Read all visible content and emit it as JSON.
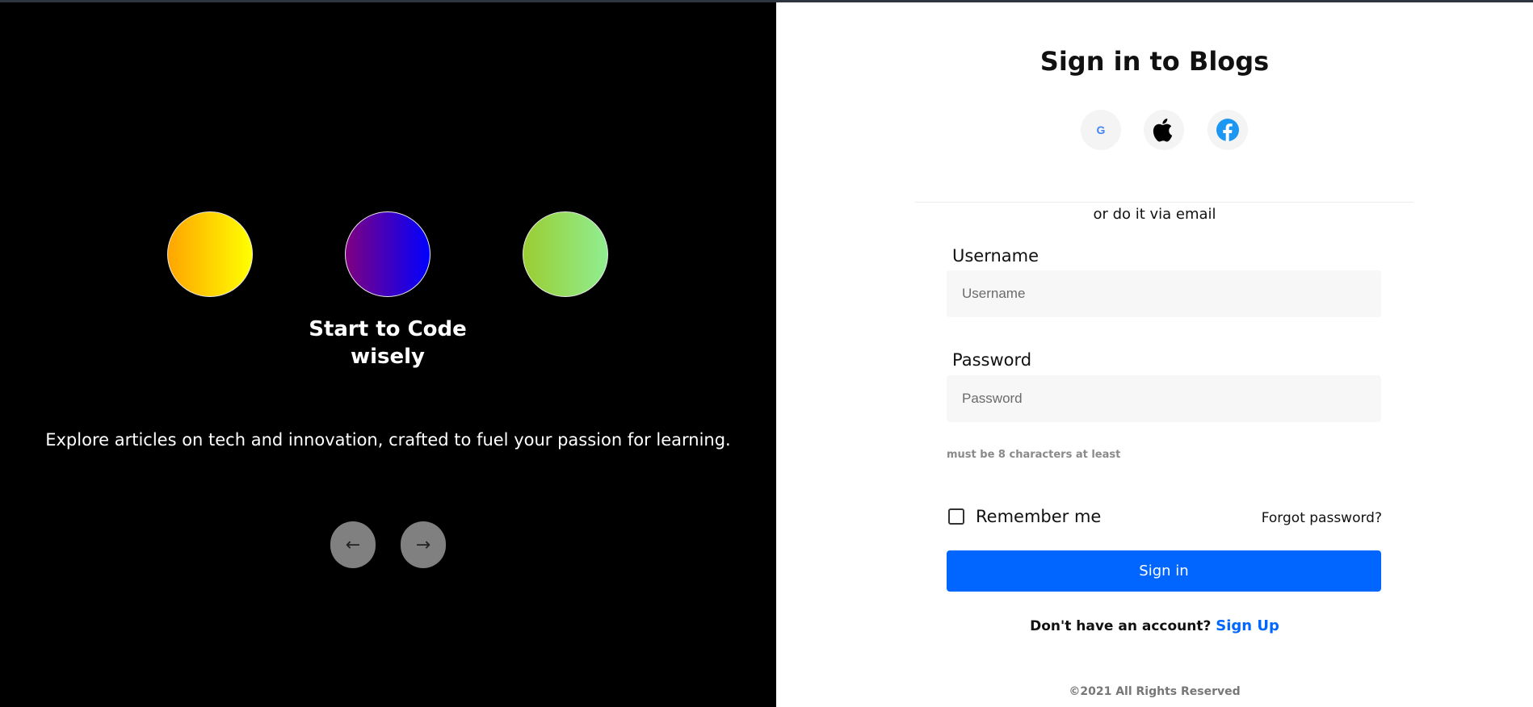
{
  "carousel": {
    "headline": "Start to Code wisely",
    "tagline": "Explore articles on tech and innovation, crafted to fuel your passion for learning.",
    "prev_label": "←",
    "next_label": "→",
    "circle_colors": [
      [
        "#ffa500",
        "#ffff00"
      ],
      [
        "#800080",
        "#0000ff"
      ],
      [
        "#9acd32",
        "#90ee90"
      ]
    ]
  },
  "form": {
    "title": "Sign in to Blogs",
    "social": [
      {
        "icon": "google-icon",
        "label": "G"
      },
      {
        "icon": "apple-icon"
      },
      {
        "icon": "facebook-icon"
      }
    ],
    "divider_text": "or do it via email",
    "username_label": "Username",
    "username_placeholder": "Username",
    "password_label": "Password",
    "password_placeholder": "Password",
    "password_hint": "must be 8 characters at least",
    "remember_label": "Remember me",
    "forgot_label": "Forgot password?",
    "submit_label": "Sign in",
    "signup_prompt": "Don't have an account?",
    "signup_link": "Sign Up",
    "footer": "©2021 All Rights Reserved",
    "accent_color": "#0066ff"
  }
}
